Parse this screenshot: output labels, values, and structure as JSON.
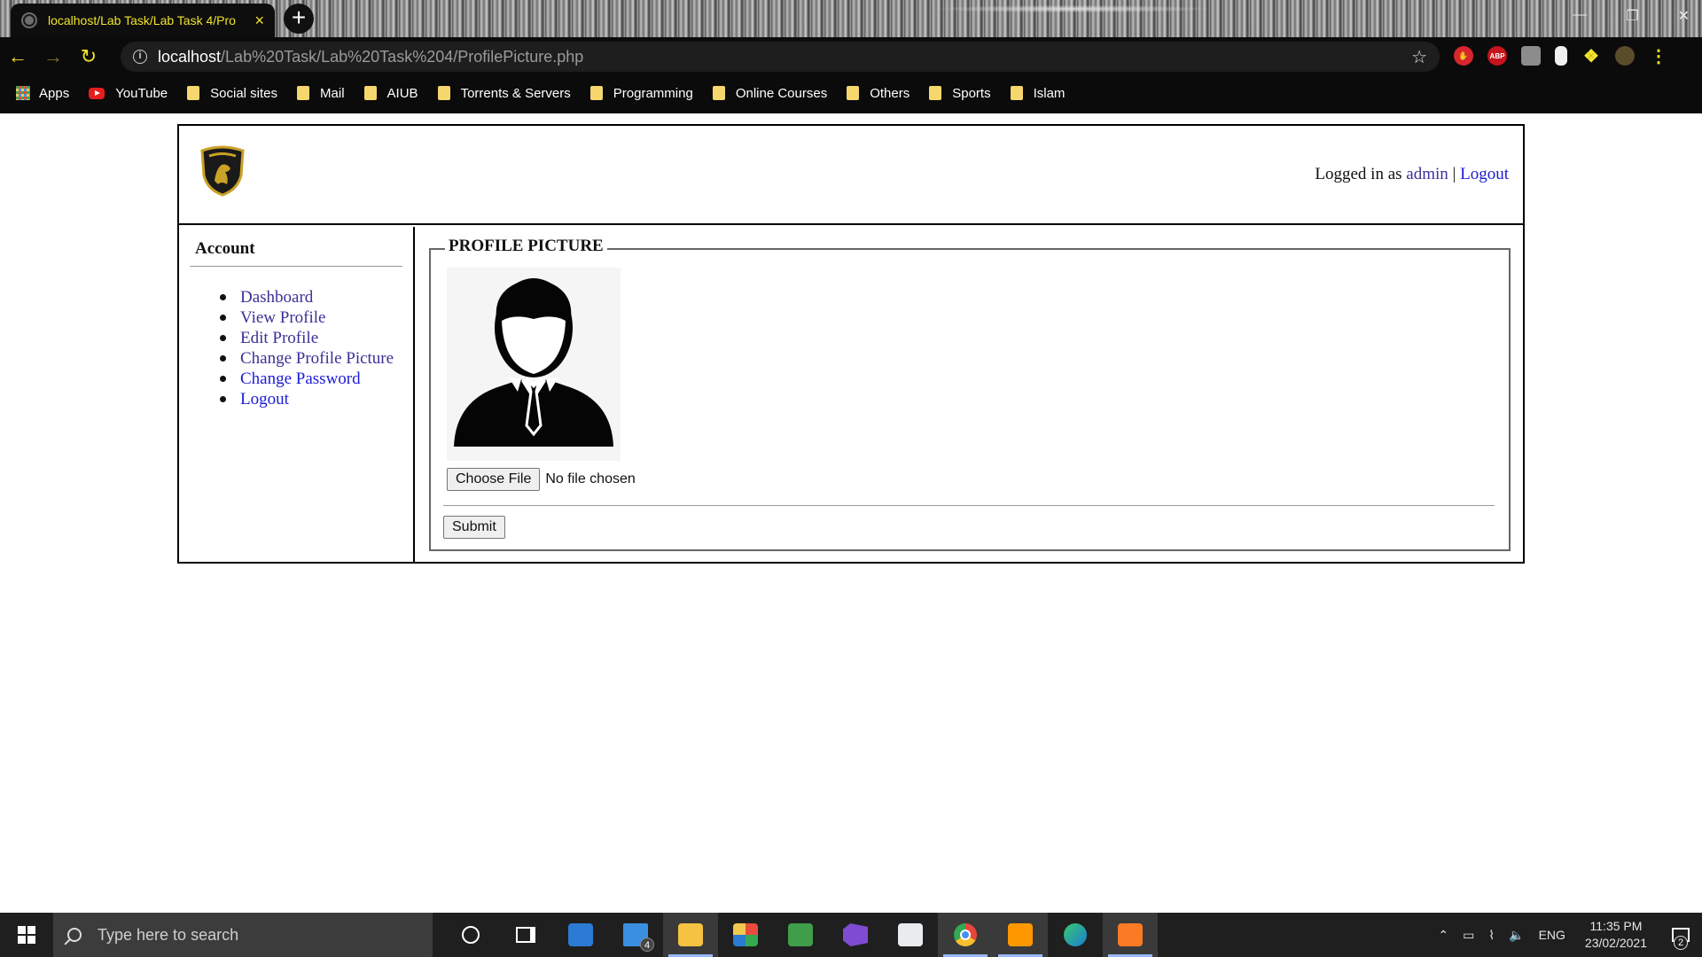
{
  "browser": {
    "tab_title": "localhost/Lab Task/Lab Task 4/Pro",
    "tab_close": "×",
    "new_tab": "+",
    "url_host": "localhost",
    "url_path": "/Lab%20Task/Lab%20Task%204/ProfilePicture.php",
    "ext_abp": "ABP",
    "bookmarks": [
      {
        "label": "Apps",
        "icon": "apps-icon"
      },
      {
        "label": "YouTube",
        "icon": "youtube-icon"
      },
      {
        "label": "Social sites",
        "icon": "folder-icon"
      },
      {
        "label": "Mail",
        "icon": "folder-icon"
      },
      {
        "label": "AIUB",
        "icon": "folder-icon"
      },
      {
        "label": "Torrents & Servers",
        "icon": "folder-icon"
      },
      {
        "label": "Programming",
        "icon": "folder-icon"
      },
      {
        "label": "Online Courses",
        "icon": "folder-icon"
      },
      {
        "label": "Others",
        "icon": "folder-icon"
      },
      {
        "label": "Sports",
        "icon": "folder-icon"
      },
      {
        "label": "Islam",
        "icon": "folder-icon"
      }
    ]
  },
  "header": {
    "login_prefix": "Logged in as ",
    "username": "admin",
    "separator": " | ",
    "logout": "Logout"
  },
  "sidebar": {
    "title": "Account",
    "items": [
      {
        "label": "Dashboard"
      },
      {
        "label": "View Profile"
      },
      {
        "label": "Edit Profile"
      },
      {
        "label": "Change Profile Picture"
      },
      {
        "label": "Change Password"
      },
      {
        "label": "Logout"
      }
    ]
  },
  "main": {
    "legend": "PROFILE PICTURE",
    "choose_file_label": "Choose File",
    "file_status": "No file chosen",
    "submit_label": "Submit"
  },
  "taskbar": {
    "search_placeholder": "Type here to search",
    "mail_badge": "4",
    "language": "ENG",
    "time": "11:35 PM",
    "date": "23/02/2021",
    "notification_count": "2"
  },
  "colors": {
    "tab_accent": "#f2e32b",
    "visited_link": "#3a3196",
    "link": "#1b1bd8"
  }
}
